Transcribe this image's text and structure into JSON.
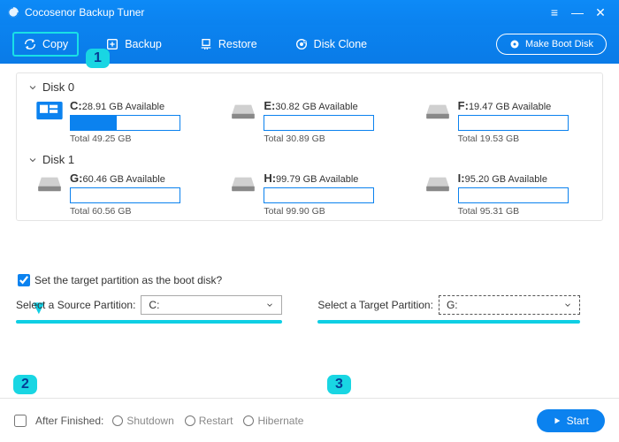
{
  "app_title": "Cocosenor Backup Tuner",
  "toolbar": {
    "copy": "Copy",
    "backup": "Backup",
    "restore": "Restore",
    "disk_clone": "Disk Clone",
    "make_boot_disk": "Make Boot Disk"
  },
  "disks": [
    {
      "name": "Disk 0",
      "partitions": [
        {
          "letter": "C:",
          "available": "28.91 GB Available",
          "total": "Total 49.25 GB",
          "fill_pct": 42,
          "system": true
        },
        {
          "letter": "E:",
          "available": "30.82 GB Available",
          "total": "Total 30.89 GB",
          "fill_pct": 0,
          "system": false
        },
        {
          "letter": "F:",
          "available": "19.47 GB Available",
          "total": "Total 19.53 GB",
          "fill_pct": 0,
          "system": false
        }
      ]
    },
    {
      "name": "Disk 1",
      "partitions": [
        {
          "letter": "G:",
          "available": "60.46 GB Available",
          "total": "Total 60.56 GB",
          "fill_pct": 0,
          "system": false
        },
        {
          "letter": "H:",
          "available": "99.79 GB Available",
          "total": "Total 99.90 GB",
          "fill_pct": 0,
          "system": false
        },
        {
          "letter": "I:",
          "available": "95.20 GB Available",
          "total": "Total 95.31 GB",
          "fill_pct": 0,
          "system": false
        }
      ]
    }
  ],
  "target_option_label": "Set the target partition as the boot disk?",
  "source_label": "Select a Source Partition:",
  "source_value": "C:",
  "target_label": "Select a Target Partition:",
  "target_value": "G:",
  "footer": {
    "after_finished": "After Finished:",
    "shutdown": "Shutdown",
    "restart": "Restart",
    "hibernate": "Hibernate",
    "start": "Start"
  },
  "callouts": {
    "c1": "1",
    "c2": "2",
    "c3": "3"
  }
}
